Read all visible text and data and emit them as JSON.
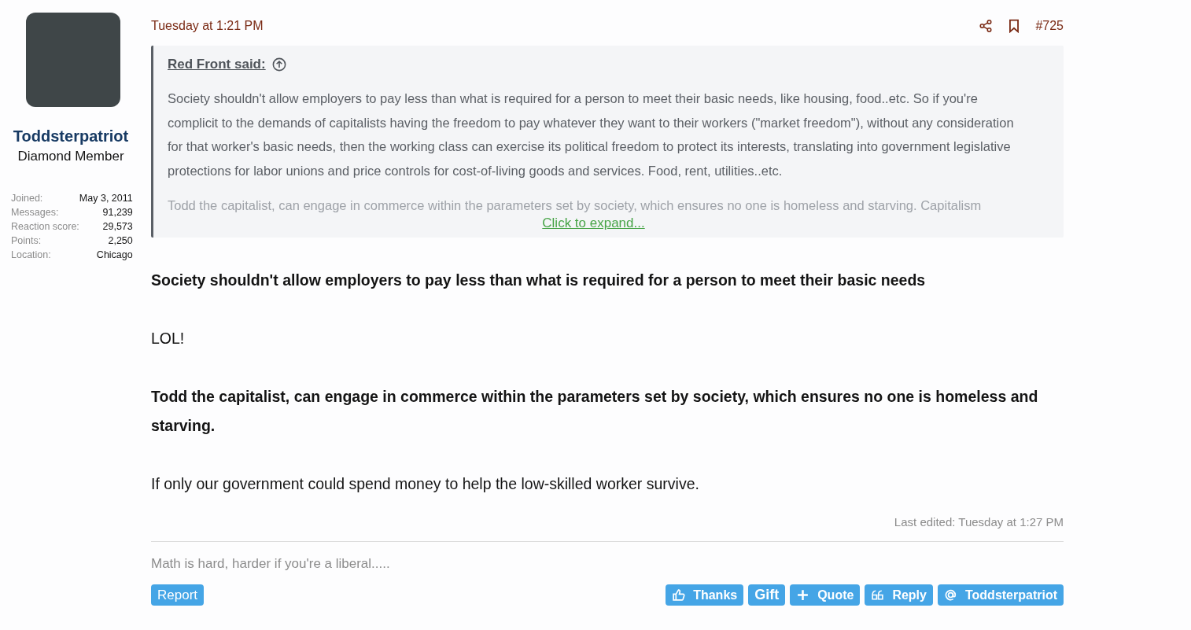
{
  "user": {
    "name": "Toddsterpatriot",
    "title": "Diamond Member",
    "stats": [
      {
        "label": "Joined:",
        "value": "May 3, 2011"
      },
      {
        "label": "Messages:",
        "value": "91,239"
      },
      {
        "label": "Reaction score:",
        "value": "29,573"
      },
      {
        "label": "Points:",
        "value": "2,250"
      },
      {
        "label": "Location:",
        "value": "Chicago"
      }
    ]
  },
  "post": {
    "date": "Tuesday at 1:21 PM",
    "number": "#725",
    "quote": {
      "author": "Red Front said:",
      "paragraphs": [
        "Society shouldn't allow employers to pay less than what is required for a person to meet their basic needs, like housing, food..etc. So if you're complicit to the demands of capitalists having the freedom to pay whatever they want to their workers (\"market freedom\"), without any consideration for that worker's basic needs, then the working class can exercise its political freedom to protect its interests, translating into government legislative protections for labor unions and price controls for cost-of-living goods and services. Food, rent, utilities..etc.",
        "Todd the capitalist, can engage in commerce within the parameters set by society, which ensures no one is homeless and starving. Capitalism"
      ],
      "expand": "Click to expand..."
    },
    "body": [
      {
        "kind": "bold",
        "text": "Society shouldn't allow employers to pay less than what is required for a person to meet their basic needs"
      },
      {
        "kind": "plain",
        "text": "LOL!"
      },
      {
        "kind": "bold",
        "text": "Todd the capitalist, can engage in commerce within the parameters set by society, which ensures no one is homeless and starving."
      },
      {
        "kind": "plain",
        "text": "If only our government could spend money to help the low-skilled worker survive."
      }
    ],
    "last_edited": "Last edited: Tuesday at 1:27 PM",
    "signature": "Math is hard, harder if you're a liberal.....",
    "report": "Report",
    "actions": [
      {
        "kind": "thanks",
        "label": "Thanks"
      },
      {
        "kind": "gift",
        "label": "Gift"
      },
      {
        "kind": "quote",
        "label": "Quote"
      },
      {
        "kind": "reply",
        "label": "Reply"
      },
      {
        "kind": "mention",
        "label": "Toddsterpatriot"
      }
    ]
  }
}
